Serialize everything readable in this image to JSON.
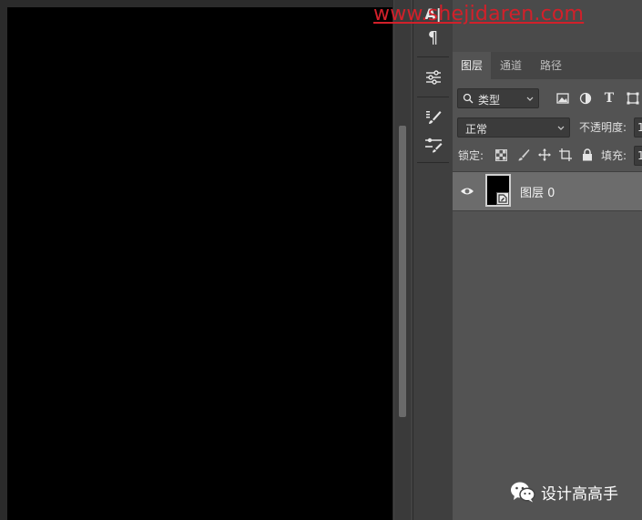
{
  "watermark": "www.shejidaren.com",
  "tools": {
    "character": "A|",
    "paragraph": "¶"
  },
  "tabs": [
    "图层",
    "通道",
    "路径"
  ],
  "filter": {
    "kind_label": "类型"
  },
  "filter_icons": {
    "text_filter": "T"
  },
  "blend_mode": "正常",
  "opacity_label": "不透明度:",
  "opacity_value": "1",
  "lock_label": "锁定:",
  "fill_label": "填充:",
  "fill_value": "1",
  "layers": [
    {
      "name": "图层 0",
      "visible": true
    }
  ],
  "wechat_label": "设计高高手",
  "colors": {
    "accent_watermark": "#d2202a",
    "canvas": "#000000",
    "panel": "#535353",
    "selected_row": "#6c6c6c"
  }
}
